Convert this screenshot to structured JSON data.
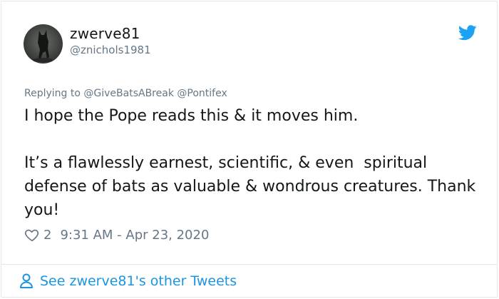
{
  "user": {
    "display_name": "zwerve81",
    "handle": "@znichols1981",
    "avatar_icon": "avatar-photo"
  },
  "reply": {
    "prefix": "Replying to ",
    "mentions": [
      "@GiveBatsABreak",
      "@Pontifex"
    ]
  },
  "tweet": {
    "lines": [
      "I hope the Pope reads this & it moves him.",
      "It’s a flawlessly earnest, scientific, & even  spiritual defense of bats as valuable & wondrous creatures. Thank you!"
    ]
  },
  "meta": {
    "likes": "2",
    "timestamp": "9:31 AM - Apr 23, 2020",
    "heart_icon": "heart-outline-icon"
  },
  "footer": {
    "link_text": "See zwerve81's other Tweets",
    "icon": "person-icon"
  },
  "colors": {
    "accent": "#1b95e0",
    "twitter_blue": "#1da1f2",
    "secondary_text": "#657786",
    "primary_text": "#14171a",
    "border": "#e1e8ed"
  }
}
